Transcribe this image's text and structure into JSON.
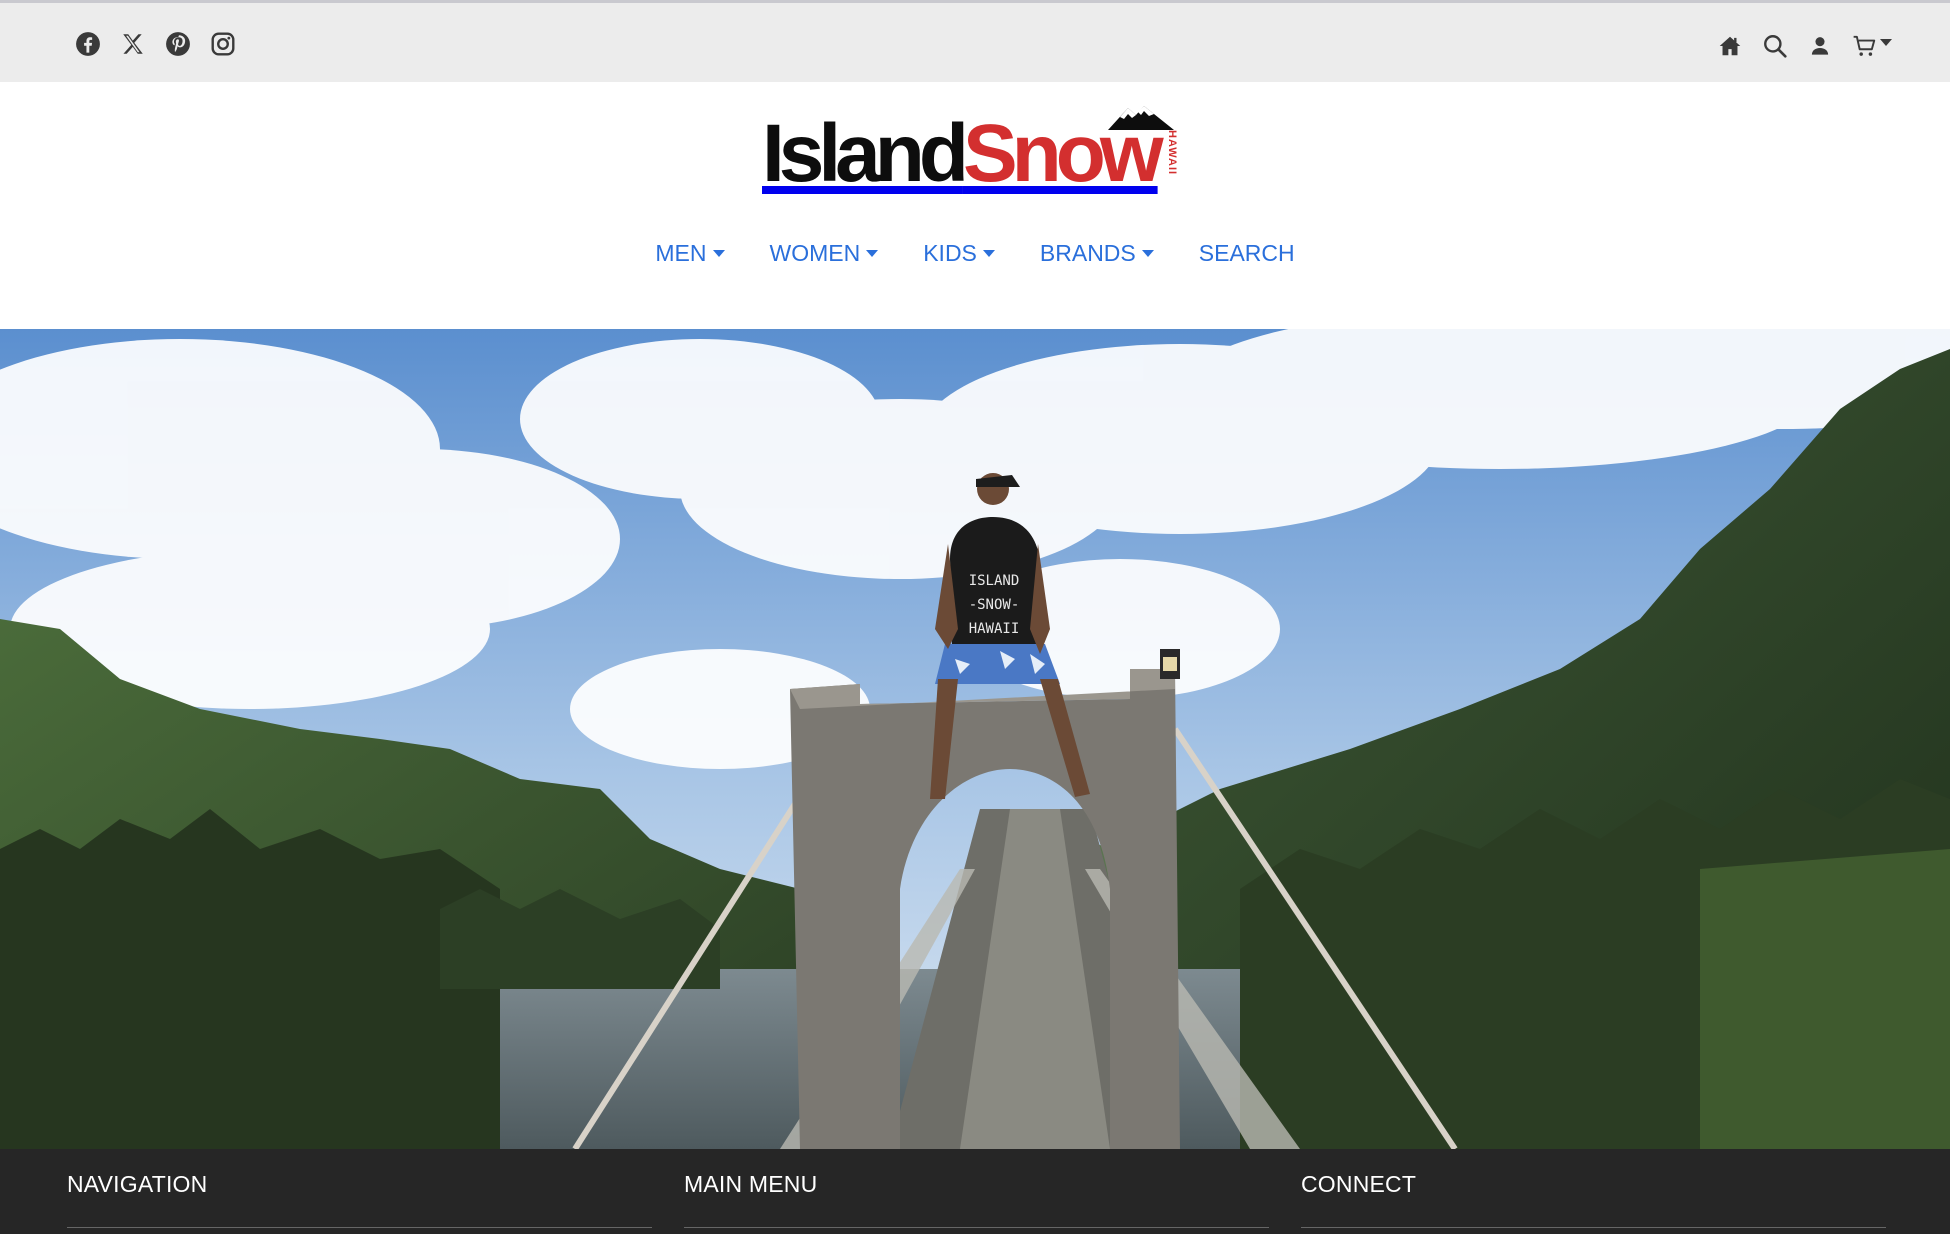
{
  "topbar": {
    "social_icons": [
      "facebook-icon",
      "x-twitter-icon",
      "pinterest-icon",
      "instagram-icon"
    ],
    "utility_icons": [
      "home-icon",
      "search-icon",
      "account-icon",
      "cart-icon"
    ]
  },
  "logo": {
    "word_black": "Island",
    "word_red": "Snow",
    "sub": "HAWAII"
  },
  "nav": {
    "items": [
      {
        "label": "MEN",
        "dropdown": true
      },
      {
        "label": "WOMEN",
        "dropdown": true
      },
      {
        "label": "KIDS",
        "dropdown": true
      },
      {
        "label": "BRANDS",
        "dropdown": true
      },
      {
        "label": "SEARCH",
        "dropdown": false
      }
    ]
  },
  "hero": {
    "shirt_text": [
      "ISLAND",
      "-SNOW-",
      "HAWAII"
    ]
  },
  "footer": {
    "columns": [
      "NAVIGATION",
      "MAIN MENU",
      "CONNECT"
    ]
  },
  "colors": {
    "nav_link": "#2a6fdb",
    "logo_red": "#d32f2f",
    "topbar_bg": "#ececec",
    "footer_bg": "#262626"
  }
}
